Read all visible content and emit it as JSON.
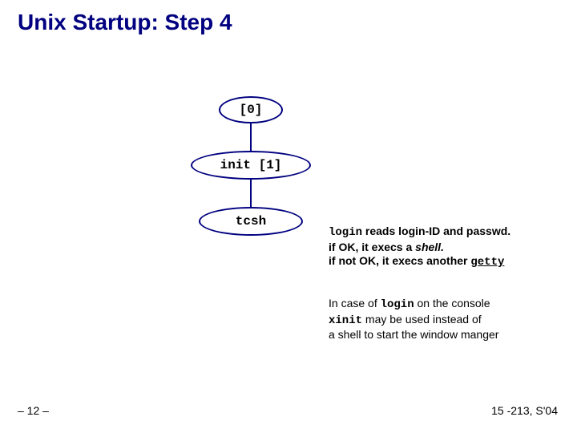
{
  "title": "Unix Startup: Step 4",
  "nodes": {
    "root": "[0]",
    "init": "init [1]",
    "shell": "tcsh"
  },
  "desc": {
    "login_cmd": "login",
    "line1_rest": " reads login-ID and passwd.",
    "line2_a": "if OK, it execs a ",
    "line2_shell": "shell.",
    "line3_a": "if not OK, it execs another ",
    "line3_getty": "getty",
    "p2_a": "In case of ",
    "p2_login": "login",
    "p2_b": " on the console",
    "p2_xinit": "xinit",
    "p2_c": " may be used instead of",
    "p2_d": "a shell to start the window manger"
  },
  "footer": {
    "left": "– 12 –",
    "right": "15 -213, S'04"
  }
}
